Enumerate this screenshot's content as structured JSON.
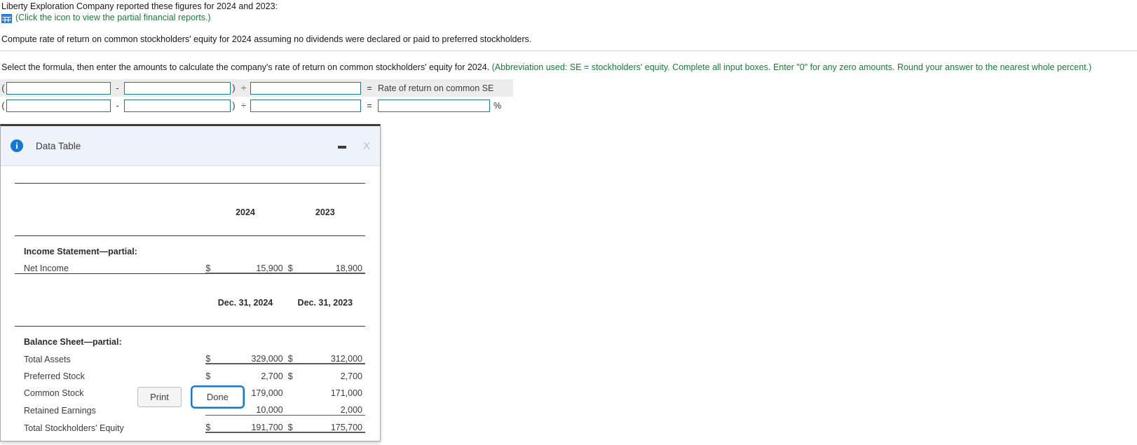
{
  "problem": {
    "intro": "Liberty Exploration Company reported these figures for 2024 and 2023:",
    "icon_name": "table-grid-icon",
    "icon_link_text": "(Click the icon to view the partial financial reports.)",
    "compute": "Compute rate of return on common stockholders' equity for 2024 assuming no dividends were declared or paid to preferred stockholders.",
    "select_instruction": "Select the formula, then enter the amounts to calculate the company's rate of return on common stockholders' equity for 2024.",
    "select_note": "(Abbreviation used: SE = stockholders' equity. Complete all input boxes. Enter \"0\" for any zero amounts. Round your answer to the nearest whole percent.)"
  },
  "formula": {
    "open_paren": "(",
    "close_paren": ")",
    "minus": "-",
    "divide": "÷",
    "equals": "=",
    "percent": "%",
    "result_label": "Rate of return on common SE",
    "row1": {
      "term1": "",
      "term2": "",
      "divisor": ""
    },
    "row2": {
      "term1": "",
      "term2": "",
      "divisor": "",
      "result": ""
    },
    "placeholder": ""
  },
  "dialog": {
    "title": "Data Table",
    "info_icon": "info-icon",
    "minimize_icon": "minimize-icon",
    "close_icon": "close-icon",
    "close_label": "X",
    "print_label": "Print",
    "done_label": "Done"
  },
  "table": {
    "col_year_2024": "2024",
    "col_year_2023": "2023",
    "col_date_2024": "Dec. 31, 2024",
    "col_date_2023": "Dec. 31, 2023",
    "currency": "$",
    "income_section": "Income Statement—partial:",
    "balance_section": "Balance Sheet—partial:",
    "rows": [
      {
        "label": "Net Income",
        "cur_a": "$",
        "val_a": "15,900",
        "cur_b": "$",
        "val_b": "18,900"
      },
      {
        "label": "Total Assets",
        "cur_a": "$",
        "val_a": "329,000",
        "cur_b": "$",
        "val_b": "312,000"
      },
      {
        "label": "Preferred Stock",
        "cur_a": "$",
        "val_a": "2,700",
        "cur_b": "$",
        "val_b": "2,700"
      },
      {
        "label": "Common Stock",
        "cur_a": "",
        "val_a": "179,000",
        "cur_b": "",
        "val_b": "171,000"
      },
      {
        "label": "Retained Earnings",
        "cur_a": "",
        "val_a": "10,000",
        "cur_b": "",
        "val_b": "2,000"
      },
      {
        "label": "Total Stockholders' Equity",
        "cur_a": "$",
        "val_a": "191,700",
        "cur_b": "$",
        "val_b": "175,700"
      }
    ]
  }
}
